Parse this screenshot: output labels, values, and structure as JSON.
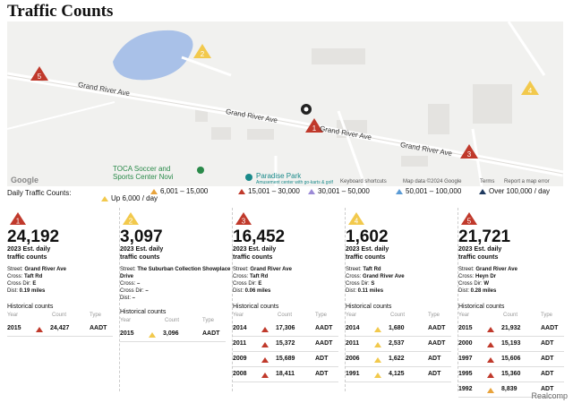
{
  "title": "Traffic Counts",
  "map": {
    "roads": [
      "Grand River Ave",
      "Grand River Ave",
      "Grand River Ave",
      "Grand River Ave"
    ],
    "pois": [
      {
        "name": "TOCA Soccer and",
        "line2": "Sports Center Novi",
        "color": "green"
      },
      {
        "name": "Paradise Park",
        "line2": "Amusement center with go-karts & golf",
        "color": "teal"
      }
    ],
    "markers": [
      {
        "num": "5",
        "level": "red"
      },
      {
        "num": "2",
        "level": "yellow"
      },
      {
        "num": "1",
        "level": "red"
      },
      {
        "num": "3",
        "level": "red"
      },
      {
        "num": "4",
        "level": "yellow"
      }
    ],
    "attribution": [
      "Keyboard shortcuts",
      "Map data ©2024 Google",
      "Terms",
      "Report a map error"
    ],
    "google": "Google"
  },
  "legend": {
    "label": "Daily Traffic Counts:",
    "items": [
      {
        "label": "Up 6,000 / day",
        "color": "#f2c94c"
      },
      {
        "label": "6,001 – 15,000",
        "color": "#e8a33c"
      },
      {
        "label": "15,001 – 30,000",
        "color": "#c0392b"
      },
      {
        "label": "30,001 – 50,000",
        "color": "#9b8ad6"
      },
      {
        "label": "50,001 – 100,000",
        "color": "#5b9bd5"
      },
      {
        "label": "Over 100,000 / day",
        "color": "#1f3a5f"
      }
    ]
  },
  "cards": [
    {
      "num": "1",
      "badge_color": "#c0392b",
      "count": "24,192",
      "sub1": "2023 Est. daily",
      "sub2": "traffic counts",
      "street_label": "Street:",
      "street": "Grand River Ave",
      "cross_label": "Cross:",
      "cross": "Taft Rd",
      "dir_label": "Cross Dir:",
      "dir": "E",
      "dist_label": "Dist:",
      "dist": "0.19 miles",
      "hist_title": "Historical counts",
      "rows": [
        {
          "year": "2015",
          "count": "24,427",
          "type": "AADT",
          "color": "#c0392b"
        }
      ]
    },
    {
      "num": "2",
      "badge_color": "#f2c94c",
      "count": "3,097",
      "sub1": "2023 Est. daily",
      "sub2": "traffic counts",
      "street_label": "Street:",
      "street": "The Suburban Collection Showplace Drive",
      "cross_label": "Cross:",
      "cross": "–",
      "dir_label": "Cross Dir:",
      "dir": "–",
      "dist_label": "Dist:",
      "dist": "–",
      "hist_title": "Historical counts",
      "rows": [
        {
          "year": "2015",
          "count": "3,096",
          "type": "AADT",
          "color": "#f2c94c"
        }
      ]
    },
    {
      "num": "3",
      "badge_color": "#c0392b",
      "count": "16,452",
      "sub1": "2023 Est. daily",
      "sub2": "traffic counts",
      "street_label": "Street:",
      "street": "Grand River Ave",
      "cross_label": "Cross:",
      "cross": "Taft Rd",
      "dir_label": "Cross Dir:",
      "dir": "E",
      "dist_label": "Dist:",
      "dist": "0.06 miles",
      "hist_title": "Historical counts",
      "rows": [
        {
          "year": "2014",
          "count": "17,306",
          "type": "AADT",
          "color": "#c0392b"
        },
        {
          "year": "2011",
          "count": "15,372",
          "type": "AADT",
          "color": "#c0392b"
        },
        {
          "year": "2009",
          "count": "15,689",
          "type": "ADT",
          "color": "#c0392b"
        },
        {
          "year": "2008",
          "count": "18,411",
          "type": "ADT",
          "color": "#c0392b"
        }
      ]
    },
    {
      "num": "4",
      "badge_color": "#f2c94c",
      "count": "1,602",
      "sub1": "2023 Est. daily",
      "sub2": "traffic counts",
      "street_label": "Street:",
      "street": "Taft Rd",
      "cross_label": "Cross:",
      "cross": "Grand River Ave",
      "dir_label": "Cross Dir:",
      "dir": "S",
      "dist_label": "Dist:",
      "dist": "0.11 miles",
      "hist_title": "Historical counts",
      "rows": [
        {
          "year": "2014",
          "count": "1,680",
          "type": "AADT",
          "color": "#f2c94c"
        },
        {
          "year": "2011",
          "count": "2,537",
          "type": "AADT",
          "color": "#f2c94c"
        },
        {
          "year": "2006",
          "count": "1,622",
          "type": "ADT",
          "color": "#f2c94c"
        },
        {
          "year": "1991",
          "count": "4,125",
          "type": "ADT",
          "color": "#f2c94c"
        }
      ]
    },
    {
      "num": "5",
      "badge_color": "#c0392b",
      "count": "21,721",
      "sub1": "2023 Est. daily",
      "sub2": "traffic counts",
      "street_label": "Street:",
      "street": "Grand River Ave",
      "cross_label": "Cross:",
      "cross": "Heyn Dr",
      "dir_label": "Cross Dir:",
      "dir": "W",
      "dist_label": "Dist:",
      "dist": "0.28 miles",
      "hist_title": "Historical counts",
      "rows": [
        {
          "year": "2015",
          "count": "21,932",
          "type": "AADT",
          "color": "#c0392b"
        },
        {
          "year": "2000",
          "count": "15,193",
          "type": "ADT",
          "color": "#c0392b"
        },
        {
          "year": "1997",
          "count": "15,606",
          "type": "ADT",
          "color": "#c0392b"
        },
        {
          "year": "1995",
          "count": "15,360",
          "type": "ADT",
          "color": "#c0392b"
        },
        {
          "year": "1992",
          "count": "8,839",
          "type": "ADT",
          "color": "#e8a33c"
        }
      ]
    }
  ],
  "hist_headers": {
    "year": "Year",
    "count": "Count",
    "type": "Type"
  },
  "footer": "Realcomp"
}
